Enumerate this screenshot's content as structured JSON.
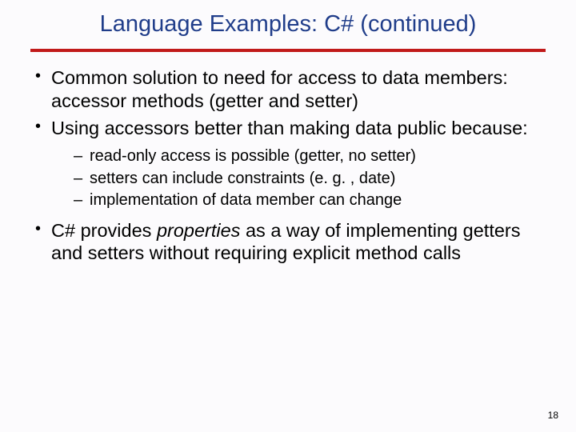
{
  "slide": {
    "title": "Language Examples: C# (continued)",
    "bullets": {
      "b1": "Common solution to need for access to data members: accessor methods (getter and setter)",
      "b2": "Using accessors better than making data public because:",
      "sub1": "read-only access is possible (getter, no setter)",
      "sub2": "setters can include constraints (e. g. , date)",
      "sub3": "implementation of data member can change",
      "b3a": "C# provides ",
      "b3b": "properties",
      "b3c": " as a way of implementing getters and setters without requiring explicit method calls"
    },
    "page": "18"
  }
}
